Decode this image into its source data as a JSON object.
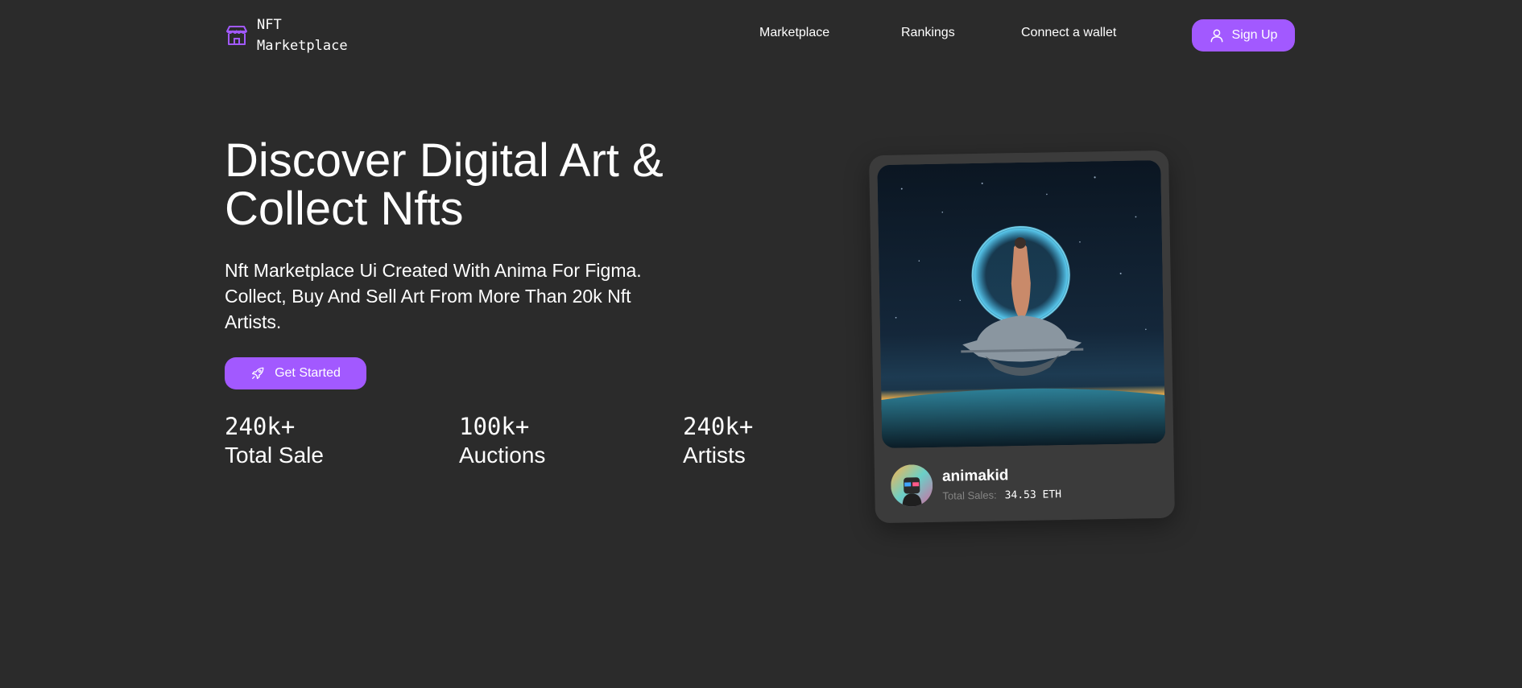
{
  "header": {
    "logo_line1": "NFT",
    "logo_line2": "Marketplace",
    "nav": [
      {
        "label": "Marketplace"
      },
      {
        "label": "Rankings"
      },
      {
        "label": "Connect a wallet"
      }
    ],
    "signup_label": "Sign Up"
  },
  "hero": {
    "headline_line1": "Discover Digital Art &",
    "headline_line2": "Collect Nfts",
    "subhead_line1": "Nft Marketplace Ui Created With Anima For Figma.",
    "subhead_line2": "Collect, Buy And Sell Art From More Than 20k Nft",
    "subhead_line3": "Artists.",
    "cta_label": "Get Started",
    "stats": [
      {
        "value": "240k+",
        "label": "Total Sale"
      },
      {
        "value": "100k+",
        "label": "Auctions"
      },
      {
        "value": "240k+",
        "label": "Artists"
      }
    ]
  },
  "featured_card": {
    "artist": "animakid",
    "sales_label": "Total Sales:",
    "sales_value": "34.53 ETH"
  },
  "colors": {
    "background": "#2b2b2b",
    "accent": "#a259ff",
    "card": "#3b3b3b",
    "muted_text": "#858584"
  },
  "icons": [
    "storefront-icon",
    "user-icon",
    "rocket-icon"
  ]
}
